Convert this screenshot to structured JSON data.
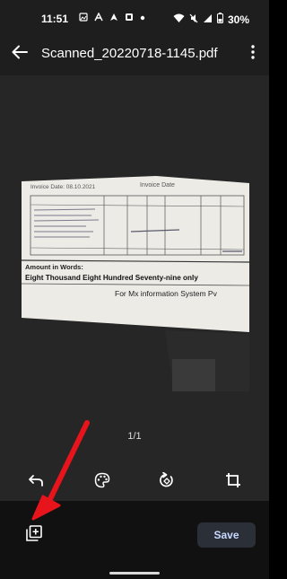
{
  "status_bar": {
    "time": "11:51",
    "battery": "30%",
    "left_icons": [
      "gallery-icon",
      "a-icon",
      "nav-icon",
      "hand-icon",
      "dot-icon"
    ],
    "right_icons": [
      "wifi-icon",
      "mute-icon",
      "signal-icon",
      "battery-icon"
    ]
  },
  "app_bar": {
    "title": "Scanned_20220718-1145.pdf"
  },
  "document": {
    "header_left": "Invoice Date: 08.10.2021",
    "header_right": "Invoice Date",
    "amount_label": "Amount in Words:",
    "amount_text": "Eight Thousand Eight Hundred Seventy-nine only",
    "company_text": "For Mx information System Pv"
  },
  "preview": {
    "page_indicator": "1/1"
  },
  "toolbar": {
    "icons": [
      "undo-icon",
      "palette-icon",
      "rotate-icon",
      "crop-icon"
    ]
  },
  "bottom_bar": {
    "save_label": "Save"
  },
  "colors": {
    "background": "#262626",
    "bar": "#1e1e1e",
    "arrow": "#e8141c",
    "save_bg": "#2a2f38"
  }
}
